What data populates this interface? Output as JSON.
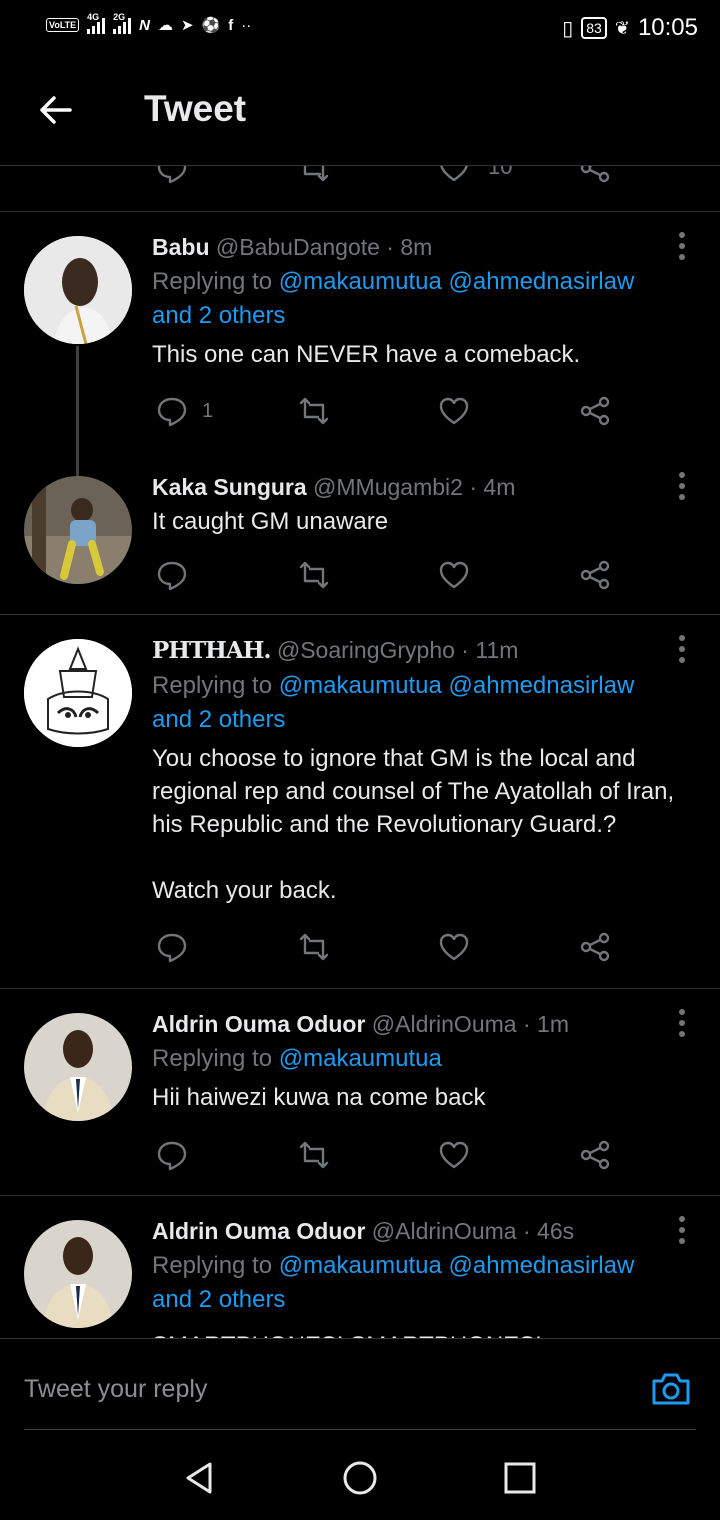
{
  "status_bar": {
    "volte": "VoLTE",
    "net1": "4G",
    "net2": "2G",
    "battery": "83",
    "time": "10:05"
  },
  "header": {
    "title": "Tweet"
  },
  "top_partial": {
    "like_count": "10"
  },
  "tweets": [
    {
      "name": "Babu",
      "handle": "@BabuDangote",
      "time": "8m",
      "replying_prefix": "Replying to ",
      "mentions": "@makaumutua @ahmednasirlaw",
      "others": "and 2 others",
      "text": "This one can NEVER have a comeback.",
      "reply_count": "1"
    },
    {
      "name": "Kaka Sungura",
      "handle": "@MMugambi2",
      "time": "4m",
      "text": "It caught GM unaware"
    },
    {
      "name": "PHTHAH.",
      "handle": "@SoaringGrypho",
      "time": "11m",
      "replying_prefix": "Replying to ",
      "mentions": "@makaumutua @ahmednasirlaw",
      "others": "and 2 others",
      "text": "You choose to ignore that GM is the local and regional rep and counsel of The Ayatollah of Iran, his Republic and the Revolutionary Guard.?\n\nWatch your back."
    },
    {
      "name": "Aldrin Ouma Oduor",
      "handle": "@AldrinOuma",
      "time": "1m",
      "replying_prefix": "Replying to ",
      "mentions": "@makaumutua",
      "text": "Hii haiwezi kuwa na come back"
    },
    {
      "name": "Aldrin Ouma Oduor",
      "handle": "@AldrinOuma",
      "time": "46s",
      "replying_prefix": "Replying to ",
      "mentions": "@makaumutua @ahmednasirlaw",
      "others": "and 2 others",
      "text": "SMARTPHONES! SMARTPHONES!"
    }
  ],
  "reply_bar": {
    "placeholder": "Tweet your reply"
  },
  "colors": {
    "accent": "#1d9bf0",
    "muted": "#71767b",
    "text": "#e7e9ea",
    "divider": "#2f3336"
  }
}
